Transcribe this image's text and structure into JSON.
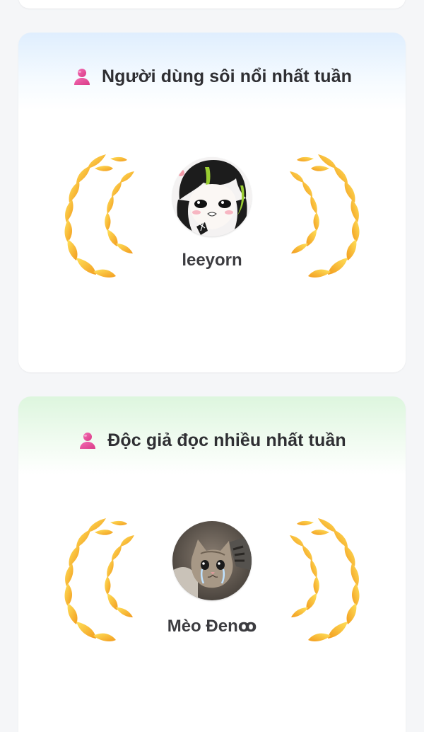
{
  "cards": [
    {
      "title": "Người dùng sôi nổi nhất tuần",
      "icon": "user-icon",
      "accent": "#dfeefe",
      "winner": {
        "username": "leeyorn",
        "avatar": "anime-girl-avatar"
      }
    },
    {
      "title": "Độc giả đọc nhiều nhất tuần",
      "icon": "user-icon",
      "accent": "#ddf6de",
      "winner": {
        "username": "Mèo Đenꝏ",
        "avatar": "crying-cat-avatar"
      }
    }
  ],
  "colors": {
    "title_text": "#2f2f33",
    "user_icon": "#e84a9b",
    "laurel_light": "#ffd84a",
    "laurel_dark": "#f39a1e"
  }
}
